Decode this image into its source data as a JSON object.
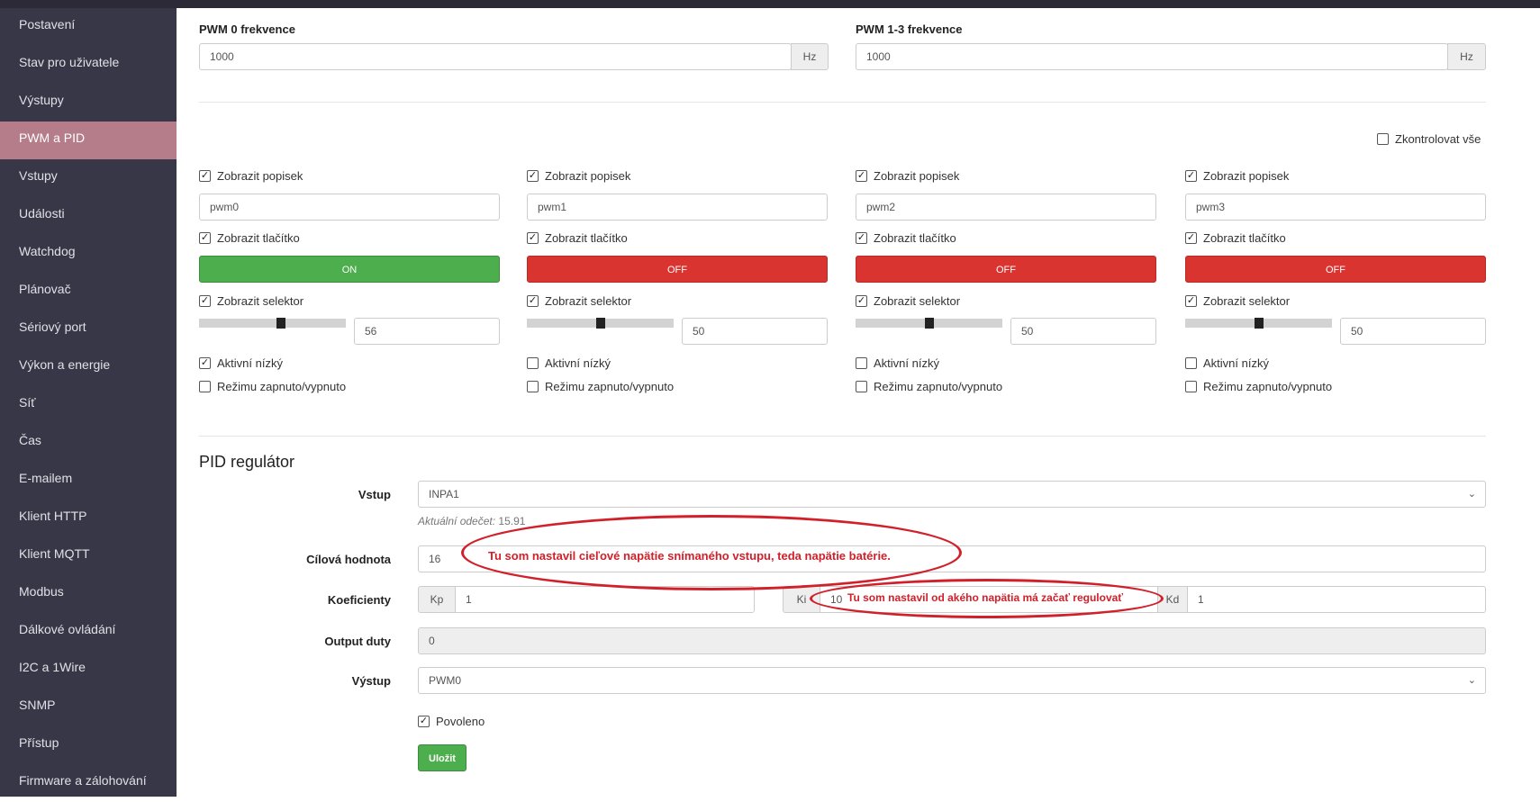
{
  "sidebar": {
    "items": [
      "Postavení",
      "Stav pro uživatele",
      "Výstupy",
      "PWM a PID",
      "Vstupy",
      "Události",
      "Watchdog",
      "Plánovač",
      "Sériový port",
      "Výkon a energie",
      "Síť",
      "Čas",
      "E-mailem",
      "Klient HTTP",
      "Klient MQTT",
      "Modbus",
      "Dálkové ovládání",
      "I2C a 1Wire",
      "SNMP",
      "Přístup",
      "Firmware a zálohování"
    ],
    "active": "PWM a PID"
  },
  "freq": [
    {
      "label": "PWM 0 frekvence",
      "value": "1000",
      "unit": "Hz"
    },
    {
      "label": "PWM 1-3 frekvence",
      "value": "1000",
      "unit": "Hz"
    }
  ],
  "check_all": "Zkontrolovat vše",
  "labels": {
    "show_label": "Zobrazit popisek",
    "show_button": "Zobrazit tlačítko",
    "show_selector": "Zobrazit selektor",
    "active_low": "Aktivní nízký",
    "onoff_mode": "Režimu zapnuto/vypnuto"
  },
  "channels": [
    {
      "name": "pwm0",
      "button": "ON",
      "state": "on",
      "value": "56",
      "level": 0.56,
      "active_low": true
    },
    {
      "name": "pwm1",
      "button": "OFF",
      "state": "off",
      "value": "50",
      "level": 0.5,
      "active_low": false
    },
    {
      "name": "pwm2",
      "button": "OFF",
      "state": "off",
      "value": "50",
      "level": 0.5,
      "active_low": false
    },
    {
      "name": "pwm3",
      "button": "OFF",
      "state": "off",
      "value": "50",
      "level": 0.5,
      "active_low": false
    }
  ],
  "pid": {
    "title": "PID regulátor",
    "input_label": "Vstup",
    "input_value": "INPA1",
    "reading_label": "Aktuální odečet:",
    "reading_value": "15.91",
    "target_label": "Cílová hodnota",
    "target_value": "16",
    "coef_label": "Koeficienty",
    "kp_label": "Kp",
    "kp": "1",
    "ki_label": "Ki",
    "ki": "10",
    "kd_label": "Kd",
    "kd": "1",
    "duty_label": "Output duty",
    "duty": "0",
    "output_label": "Výstup",
    "output_value": "PWM0",
    "enabled_label": "Povoleno",
    "save": "Uložit"
  },
  "annotations": [
    "Tu som nastavil cieľové napätie snímaného vstupu, teda napätie batérie.",
    "Tu som nastavil od akého napätia má začať regulovať"
  ],
  "colors": {
    "accent": "#b57c89",
    "on": "#4cae4c",
    "off": "#d9342f",
    "annotation": "#d2202a"
  }
}
